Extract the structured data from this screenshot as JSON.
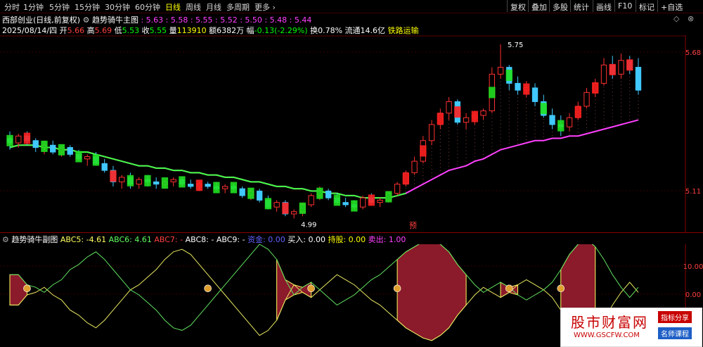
{
  "toolbar": {
    "periods": [
      "分时",
      "1分钟",
      "5分钟",
      "15分钟",
      "30分钟",
      "60分钟",
      "日线",
      "周线",
      "月线",
      "多周期",
      "更多"
    ],
    "active_period": "日线",
    "right_buttons": [
      "复权",
      "叠加",
      "多股",
      "统计",
      "画线",
      "F10",
      "标记",
      "+自选"
    ]
  },
  "stock": {
    "name": "西部创业",
    "adjust": "(日线,前复权)",
    "indicator_name": "趋势骑牛主图",
    "ma_values": ": 5.63 : 5.58 : 5.55 : 5.52 : 5.50 : 5.48 : 5.44"
  },
  "quote": {
    "date": "2025/08/14/四",
    "open_label": "开",
    "open": "5.66",
    "high_label": "高",
    "high": "5.69",
    "low_label": "低",
    "low": "5.53",
    "close_label": "收",
    "close": "5.55",
    "volume_label": "量",
    "volume": "113910",
    "amount_label": "额",
    "amount": "6382万",
    "change_label": "幅",
    "change": "-0.13(-2.29%)",
    "turnover_label": "换",
    "turnover": "0.78%",
    "float_label": "流通",
    "float_cap": "14.6亿",
    "sector": "铁路运输"
  },
  "main_annotations": {
    "max": "5.75",
    "min": "4.99",
    "yu_marker": "预"
  },
  "sub_panel": {
    "title": "趋势骑牛副图",
    "items": [
      {
        "label": "ABC5: -4.61",
        "color": "#ffff60"
      },
      {
        "label": "ABC6: 4.61",
        "color": "#60ff60"
      },
      {
        "label": "ABC7: -",
        "color": "#ff4040"
      },
      {
        "label": "ABC8: -",
        "color": "#ffffff"
      },
      {
        "label": "ABC9: -",
        "color": "#ffffff"
      },
      {
        "label": "资金: 0.00",
        "color": "#6060ff"
      },
      {
        "label": "买入: 0.00",
        "color": "#ffffff"
      },
      {
        "label": "持股: 0.00",
        "color": "#ffff00"
      },
      {
        "label": "卖出: 1.00",
        "color": "#ff40ff"
      }
    ]
  },
  "watermark": {
    "title": "股市财富网",
    "url": "WWW.GSCFW.COM",
    "tag1": "指标分享",
    "tag2": "名师课程"
  },
  "chart_data": [
    {
      "type": "candlestick",
      "title": "趋势骑牛主图",
      "y_axis_labels": [
        "5.68",
        "5.11"
      ],
      "ylim": [
        4.93,
        5.79
      ],
      "max_label": "5.75",
      "min_label": "4.99",
      "candles": [
        [
          5.34,
          5.37,
          5.29,
          5.32
        ],
        [
          5.32,
          5.36,
          5.3,
          5.35
        ],
        [
          5.35,
          5.37,
          5.31,
          5.33
        ],
        [
          5.33,
          5.34,
          5.28,
          5.3
        ],
        [
          5.3,
          5.33,
          5.27,
          5.31
        ],
        [
          5.31,
          5.33,
          5.27,
          5.28
        ],
        [
          5.28,
          5.31,
          5.26,
          5.3
        ],
        [
          5.3,
          5.31,
          5.26,
          5.27
        ],
        [
          5.27,
          5.29,
          5.24,
          5.25
        ],
        [
          5.25,
          5.27,
          5.22,
          5.26
        ],
        [
          5.26,
          5.28,
          5.22,
          5.23
        ],
        [
          5.23,
          5.25,
          5.19,
          5.2
        ],
        [
          5.2,
          5.22,
          5.13,
          5.15
        ],
        [
          5.15,
          5.18,
          5.12,
          5.17
        ],
        [
          5.17,
          5.19,
          5.12,
          5.14
        ],
        [
          5.14,
          5.17,
          5.12,
          5.16
        ],
        [
          5.16,
          5.18,
          5.13,
          5.15
        ],
        [
          5.15,
          5.17,
          5.12,
          5.14
        ],
        [
          5.14,
          5.16,
          5.12,
          5.15
        ],
        [
          5.15,
          5.17,
          5.13,
          5.16
        ],
        [
          5.16,
          5.17,
          5.13,
          5.14
        ],
        [
          5.14,
          5.16,
          5.12,
          5.13
        ],
        [
          5.13,
          5.15,
          5.11,
          5.14
        ],
        [
          5.14,
          5.15,
          5.12,
          5.13
        ],
        [
          5.13,
          5.15,
          5.11,
          5.12
        ],
        [
          5.12,
          5.14,
          5.1,
          5.13
        ],
        [
          5.13,
          5.14,
          5.11,
          5.12
        ],
        [
          5.12,
          5.13,
          5.08,
          5.09
        ],
        [
          5.09,
          5.12,
          5.07,
          5.11
        ],
        [
          5.11,
          5.12,
          5.06,
          5.07
        ],
        [
          5.07,
          5.09,
          5.03,
          5.04
        ],
        [
          5.04,
          5.07,
          5.02,
          5.06
        ],
        [
          5.06,
          5.07,
          5.0,
          5.01
        ],
        [
          5.01,
          5.03,
          4.99,
          5.02
        ],
        [
          5.02,
          5.06,
          5.0,
          5.05
        ],
        [
          5.05,
          5.1,
          5.04,
          5.09
        ],
        [
          5.09,
          5.13,
          5.07,
          5.11
        ],
        [
          5.11,
          5.12,
          5.07,
          5.08
        ],
        [
          5.08,
          5.1,
          5.05,
          5.06
        ],
        [
          5.06,
          5.08,
          5.04,
          5.05
        ],
        [
          5.05,
          5.07,
          5.03,
          5.04
        ],
        [
          5.04,
          5.09,
          5.03,
          5.08
        ],
        [
          5.08,
          5.1,
          5.05,
          5.06
        ],
        [
          5.06,
          5.08,
          5.04,
          5.07
        ],
        [
          5.07,
          5.11,
          5.06,
          5.1
        ],
        [
          5.1,
          5.15,
          5.09,
          5.14
        ],
        [
          5.14,
          5.2,
          5.13,
          5.19
        ],
        [
          5.19,
          5.26,
          5.18,
          5.24
        ],
        [
          5.24,
          5.35,
          5.23,
          5.33
        ],
        [
          5.33,
          5.42,
          5.31,
          5.4
        ],
        [
          5.4,
          5.47,
          5.38,
          5.45
        ],
        [
          5.45,
          5.52,
          5.42,
          5.5
        ],
        [
          5.5,
          5.51,
          5.4,
          5.41
        ],
        [
          5.41,
          5.45,
          5.38,
          5.43
        ],
        [
          5.43,
          5.46,
          5.4,
          5.44
        ],
        [
          5.44,
          5.47,
          5.42,
          5.46
        ],
        [
          5.46,
          5.65,
          5.45,
          5.62
        ],
        [
          5.62,
          5.75,
          5.6,
          5.65
        ],
        [
          5.65,
          5.66,
          5.55,
          5.58
        ],
        [
          5.58,
          5.61,
          5.53,
          5.55
        ],
        [
          5.55,
          5.59,
          5.52,
          5.56
        ],
        [
          5.56,
          5.58,
          5.48,
          5.5
        ],
        [
          5.5,
          5.53,
          5.43,
          5.44
        ],
        [
          5.44,
          5.47,
          5.38,
          5.4
        ],
        [
          5.4,
          5.44,
          5.35,
          5.39
        ],
        [
          5.39,
          5.45,
          5.37,
          5.43
        ],
        [
          5.43,
          5.5,
          5.42,
          5.48
        ],
        [
          5.48,
          5.56,
          5.47,
          5.54
        ],
        [
          5.54,
          5.6,
          5.52,
          5.58
        ],
        [
          5.58,
          5.69,
          5.57,
          5.66
        ],
        [
          5.66,
          5.7,
          5.6,
          5.62
        ],
        [
          5.62,
          5.71,
          5.6,
          5.68
        ],
        [
          5.68,
          5.7,
          5.62,
          5.64
        ],
        [
          5.65,
          5.69,
          5.53,
          5.55
        ]
      ],
      "series": [
        {
          "values": [
            5.3,
            5.31,
            5.31,
            5.31,
            5.3,
            5.3,
            5.29,
            5.29,
            5.28,
            5.28,
            5.27,
            5.26,
            5.25,
            5.24,
            5.23,
            5.22,
            5.22,
            5.21,
            5.21,
            5.2,
            5.2,
            5.19,
            5.19,
            5.18,
            5.18,
            5.17,
            5.17,
            5.16,
            5.15,
            5.15,
            5.14,
            5.13,
            5.13,
            5.12,
            5.12,
            5.11,
            5.11,
            5.1,
            5.1,
            5.09,
            5.09,
            5.08,
            5.08,
            5.08,
            5.08,
            5.09,
            5.1,
            5.12,
            5.14,
            5.16,
            5.18,
            5.2,
            5.21,
            5.22,
            5.24,
            5.25,
            5.27,
            5.29,
            5.3,
            5.31,
            5.32,
            5.33,
            5.33,
            5.34,
            5.34,
            5.35,
            5.35,
            5.36,
            5.37,
            5.38,
            5.39,
            5.4,
            5.41,
            5.42
          ]
        }
      ]
    },
    {
      "type": "area",
      "title": "趋势骑牛副图",
      "y_axis_labels": [
        "10.00",
        "0.00"
      ],
      "ylim": [
        -22,
        18
      ]
    }
  ]
}
